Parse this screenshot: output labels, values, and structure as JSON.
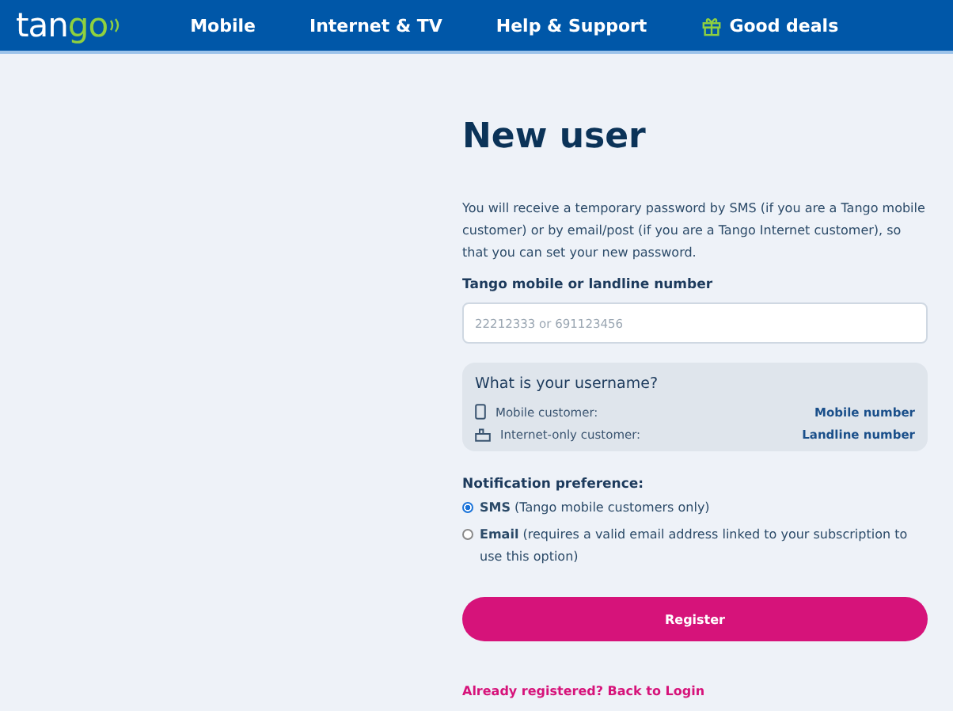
{
  "header": {
    "logo": {
      "part_1": "tan",
      "part_2": "go"
    },
    "nav": [
      {
        "label": "Mobile",
        "kind": "text"
      },
      {
        "label": "Internet & TV",
        "kind": "text"
      },
      {
        "label": "Help & Support",
        "kind": "text"
      },
      {
        "label": "Good deals",
        "kind": "gift"
      }
    ]
  },
  "form": {
    "title": "New user",
    "intro": "You will receive a temporary password by SMS (if you are a Tango mobile customer) or by email/post (if you are a Tango Internet customer), so that you can set your new password.",
    "number_label": "Tango mobile or landline number",
    "number_placeholder": "22212333 or 691123456",
    "username_box": {
      "title": "What is your username?",
      "rows": [
        {
          "kind": "mobile",
          "label": "Mobile customer:",
          "value": "Mobile number"
        },
        {
          "kind": "landline",
          "label": "Internet-only customer:",
          "value": "Landline number"
        }
      ]
    },
    "notification_label": "Notification preference:",
    "options": [
      {
        "label": "**SMS** (Tango mobile customers only)",
        "selected": true
      },
      {
        "label": "**Email** (requires a valid email address linked to your subscription to use this option)",
        "selected": false
      }
    ],
    "register_button": "Register",
    "login_link": "Already registered? Back to Login"
  }
}
